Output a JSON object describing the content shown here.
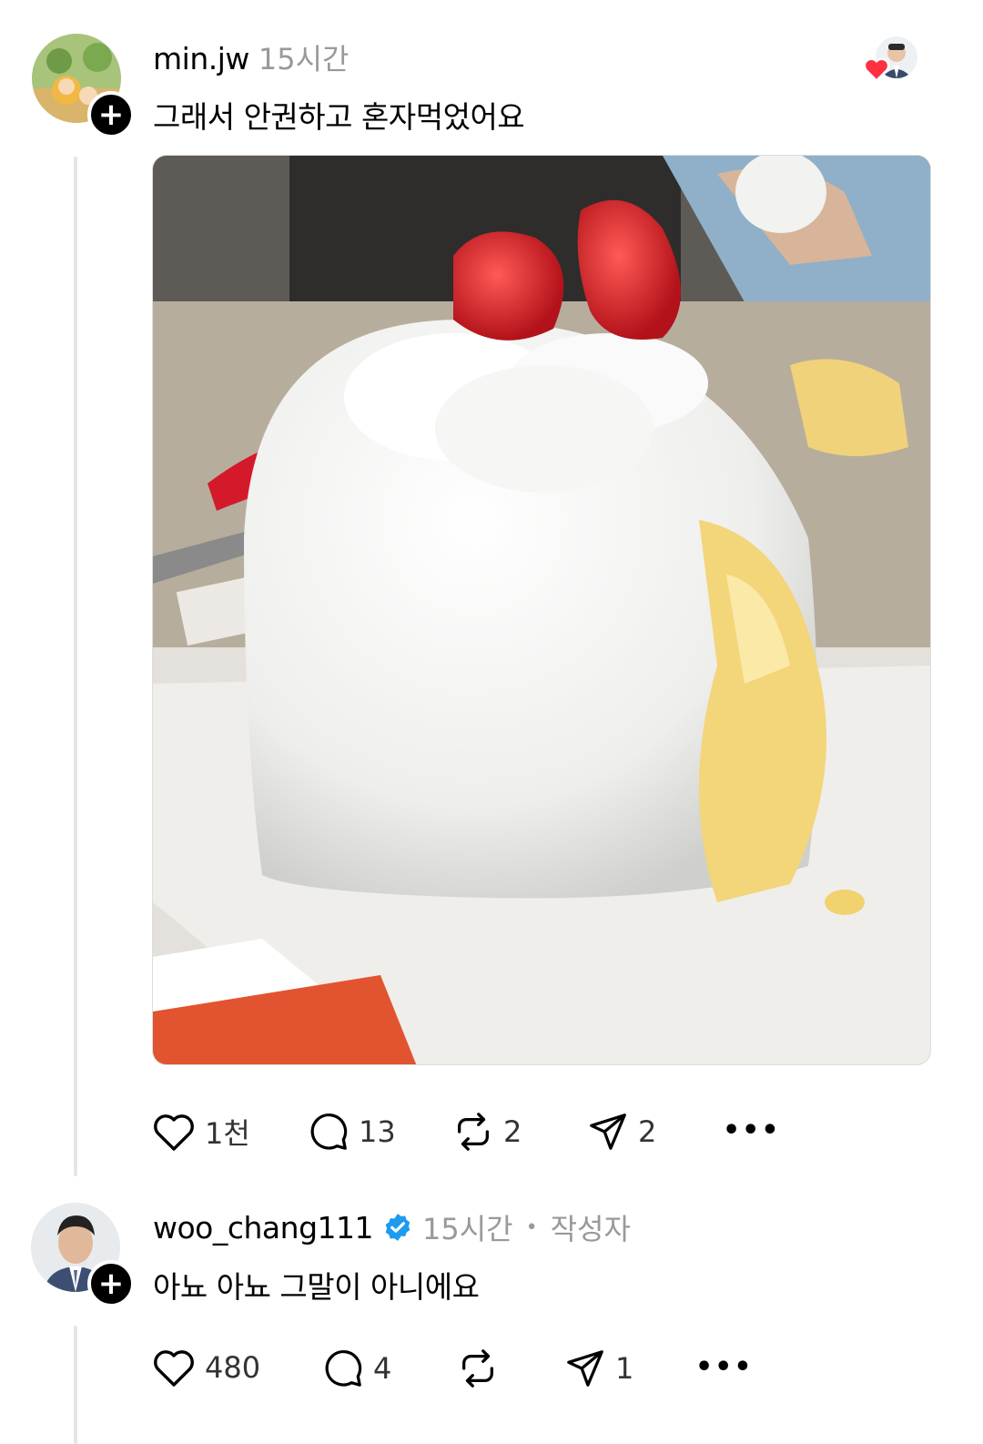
{
  "post": {
    "username": "min.jw",
    "time": "15시간",
    "text": "그래서 안권하고 혼자먹었어요",
    "image_alt": "딸기 생크림 케이크",
    "actions": {
      "likes": "1천",
      "comments": "13",
      "reposts": "2",
      "shares": "2"
    }
  },
  "reply": {
    "username": "woo_chang111",
    "time": "15시간",
    "separator": "•",
    "author_badge": "작성자",
    "text": "아뇨 아뇨 그말이 아니에요",
    "actions": {
      "likes": "480",
      "comments": "4",
      "reposts": "",
      "shares": "1"
    }
  },
  "colors": {
    "verified": "#1d9bf0",
    "heart": "#ff3040"
  }
}
